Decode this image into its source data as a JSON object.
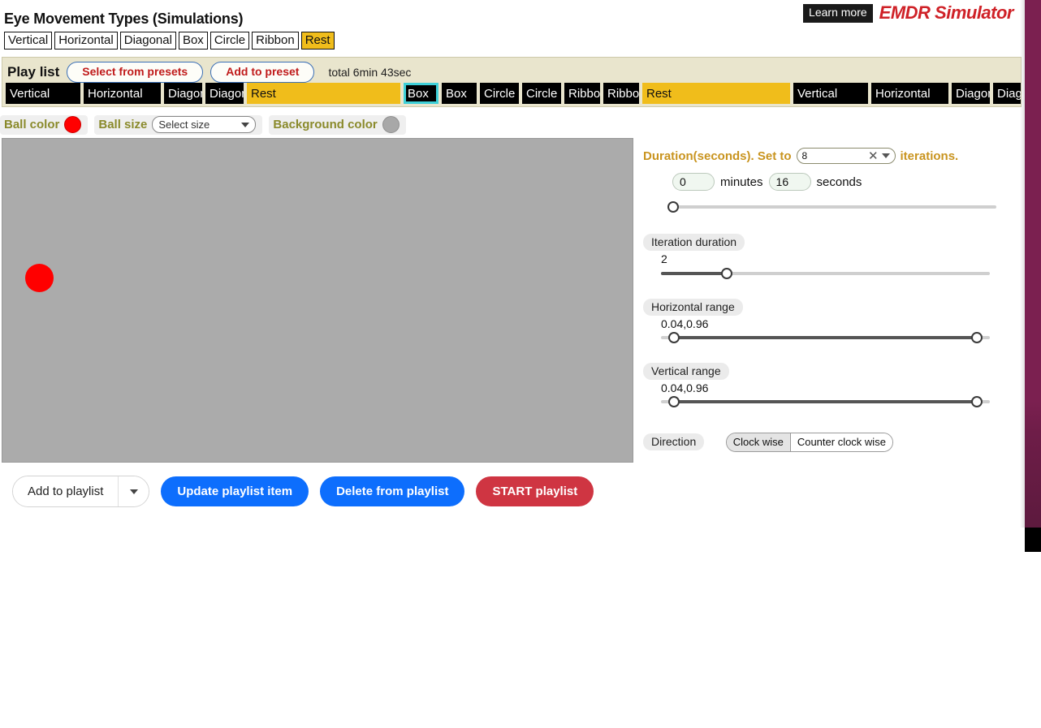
{
  "header": {
    "title": "Eye Movement Types (Simulations)",
    "learn_more_label": "Learn more",
    "brand": "EMDR Simulator",
    "movement_types": [
      {
        "label": "Vertical",
        "selected": false
      },
      {
        "label": "Horizontal",
        "selected": false
      },
      {
        "label": "Diagonal",
        "selected": false
      },
      {
        "label": "Box",
        "selected": false
      },
      {
        "label": "Circle",
        "selected": false
      },
      {
        "label": "Ribbon",
        "selected": false
      },
      {
        "label": "Rest",
        "selected": true
      }
    ]
  },
  "playlist": {
    "label": "Play list",
    "select_presets_label": "Select from presets",
    "add_preset_label": "Add to preset",
    "total_label": "total 6min 43sec",
    "items": [
      {
        "label": "Vertical",
        "type": "move",
        "selected": false,
        "width": 92
      },
      {
        "label": "Horizontal",
        "type": "move",
        "selected": false,
        "width": 95
      },
      {
        "label": "Diagonal",
        "type": "move",
        "selected": false,
        "width": 47
      },
      {
        "label": "Diagonal",
        "type": "move",
        "selected": false,
        "width": 47
      },
      {
        "label": "Rest",
        "type": "rest",
        "selected": false,
        "width": 189
      },
      {
        "label": "Box",
        "type": "move",
        "selected": true,
        "width": 43
      },
      {
        "label": "Box",
        "type": "move",
        "selected": false,
        "width": 43
      },
      {
        "label": "Circle",
        "type": "move",
        "selected": false,
        "width": 48
      },
      {
        "label": "Circle",
        "type": "move",
        "selected": false,
        "width": 48
      },
      {
        "label": "Ribbon",
        "type": "move",
        "selected": false,
        "width": 44
      },
      {
        "label": "Ribbon",
        "type": "move",
        "selected": false,
        "width": 44
      },
      {
        "label": "Rest",
        "type": "rest",
        "selected": false,
        "width": 182
      },
      {
        "label": "Vertical",
        "type": "move",
        "selected": false,
        "width": 92
      },
      {
        "label": "Horizontal",
        "type": "move",
        "selected": false,
        "width": 95
      },
      {
        "label": "Diagonal",
        "type": "move",
        "selected": false,
        "width": 47
      },
      {
        "label": "Diagonal",
        "type": "move",
        "selected": false,
        "width": 47
      }
    ]
  },
  "ball_settings": {
    "ball_color_label": "Ball color",
    "ball_color_value": "#ff0000",
    "ball_size_label": "Ball size",
    "ball_size_placeholder": "Select size",
    "background_color_label": "Background color",
    "background_color_value": "#a8a8a8"
  },
  "stage": {
    "background_color": "#ababab",
    "ball_color": "#ff0000"
  },
  "controls": {
    "duration_prefix": "Duration(seconds). Set to",
    "duration_suffix": "iterations.",
    "iterations_value": "8",
    "clear_icon": "✕",
    "minutes_value": "0",
    "minutes_label": "minutes",
    "seconds_value": "16",
    "seconds_label": "seconds",
    "duration_slider": {
      "pct": 1
    },
    "iteration_duration": {
      "label": "Iteration duration",
      "value": "2",
      "pct": 20
    },
    "horizontal_range": {
      "label": "Horizontal range",
      "value": "0.04,0.96",
      "low_pct": 4,
      "high_pct": 96
    },
    "vertical_range": {
      "label": "Vertical range",
      "value": "0.04,0.96",
      "low_pct": 4,
      "high_pct": 96
    },
    "direction": {
      "label": "Direction",
      "options": [
        {
          "label": "Clock wise",
          "selected": true
        },
        {
          "label": "Counter clock wise",
          "selected": false
        }
      ]
    }
  },
  "actions": {
    "add_to_playlist_label": "Add to playlist",
    "update_item_label": "Update playlist item",
    "delete_item_label": "Delete from playlist",
    "start_label": "START playlist"
  }
}
